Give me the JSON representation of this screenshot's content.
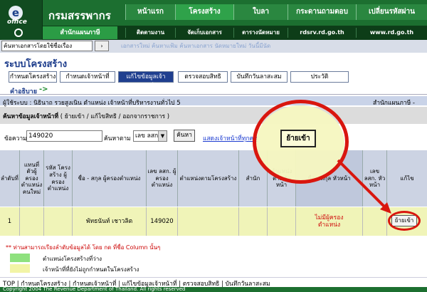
{
  "header": {
    "logo_letter": "e",
    "logo_text": "office",
    "site_title": "กรมสรรพากร",
    "main_nav": [
      "หน้าแรก",
      "โครงสร้าง",
      "ใบลา",
      "กระดานถามตอบ",
      "เปลี่ยนรหัสผ่าน"
    ],
    "unit_label": "สำนักแผนภาษี",
    "sub_nav": [
      "ติดตามงาน",
      "จัดเก็บเอกสาร",
      "ตารางนัดหมาย",
      "rdsrv.rd.go.th",
      "www.rd.go.th"
    ]
  },
  "search": {
    "placeholder": "ค้นหาเอกสารโดยใช้ชื่อเรื่อง",
    "go_label": "›",
    "ghost_links": "เอกสารใหม่   ค้นหาแฟ้ม   ค้นหาเอกสาร   นัดหมายใหม่   วันนี้มีนัด"
  },
  "system": {
    "title": "ระบบโครงสร้าง",
    "tabs": [
      "กำหนดโครงสร้าง",
      "กำหนดเจ้าหน้าที่",
      "แก้ไขข้อมูลเจ้าหน้าที่",
      "ตรวจสอบสิทธิ",
      "บันทึกวันลาสะสม",
      "ประวัติ"
    ],
    "help_link": "คำอธิบาย",
    "help_arrow": "->"
  },
  "user_bar": {
    "text": "ผู้ใช้ระบบ : นิธินาถ รวยสูงเนิน  ตำแหน่ง เจ้าหน้าที่บริหารงานทั่วไป 5",
    "unit": "สำนักแผนภาษี -"
  },
  "panel": {
    "title_bold": "ค้นหาข้อมูลเจ้าหน้าที่",
    "title_rest": " ( ย้ายเข้า / แก้ไขสิทธิ / ออกจากราชการ )"
  },
  "filter": {
    "keyword_label": "ข้อความ",
    "keyword_value": "149020",
    "by_label": "ค้นหาตาม",
    "by_value": "เลข ลสก",
    "find_label": "ค้นหา",
    "show_all_label": "แสดงเจ้าหน้าที่ทุกคน"
  },
  "table": {
    "headers": [
      "ลำดับที่",
      "แทนที่ ตัวผู้ ครอง ตำแหน่ง คนใหม่",
      "รหัส โครง สร้าง ผู้ ครอง ตำแหน่ง",
      "ชื่อ - สกุล ผู้ครองตำแหน่ง",
      "เลข ลสก. ผู้ครอง ตำแหน่ง",
      "ตำแหน่งตามโครงสร้าง",
      "สำนัก",
      "ตำแหน่ง ตามหัว หน้า",
      "ชื่อ - สกุล หัวหน้า",
      "เลข ลสก. หัว หน้า",
      "แก้ไข"
    ],
    "rows": [
      {
        "no": "1",
        "name": "พัทธนันท์ เชาวลิต",
        "lsk": "149020",
        "head_name": "ไม่มีผู้ครองตำแหน่ง",
        "action": "ย้ายเข้า"
      }
    ]
  },
  "legend": {
    "note": "** ท่านสามารถเรียงลำดับข้อมูลได้ โดย กด ที่ชื่อ Column นั้นๆ",
    "green": "ตำแหน่งโครงสร้างที่ว่าง",
    "yellow": "เจ้าหน้าที่ที่ยังไม่ถูกกำหนดในโครงสร้าง",
    "green_color": "#8ee17e",
    "yellow_color": "#f2f4a6"
  },
  "footer": {
    "nav": "TOP  |  กำหนดโครงสร้าง  |  กำหนดเจ้าหน้าที่  |  แก้ไขข้อมูลเจ้าหน้าที่  |  ตรวจสอบสิทธิ  |  บันทึกวันลาสะสม",
    "copyright": "Copyright 2004 The Revenue Department of Thailand. All rights reserved"
  },
  "zoom": {
    "button_label": "ย้ายเข้า"
  }
}
